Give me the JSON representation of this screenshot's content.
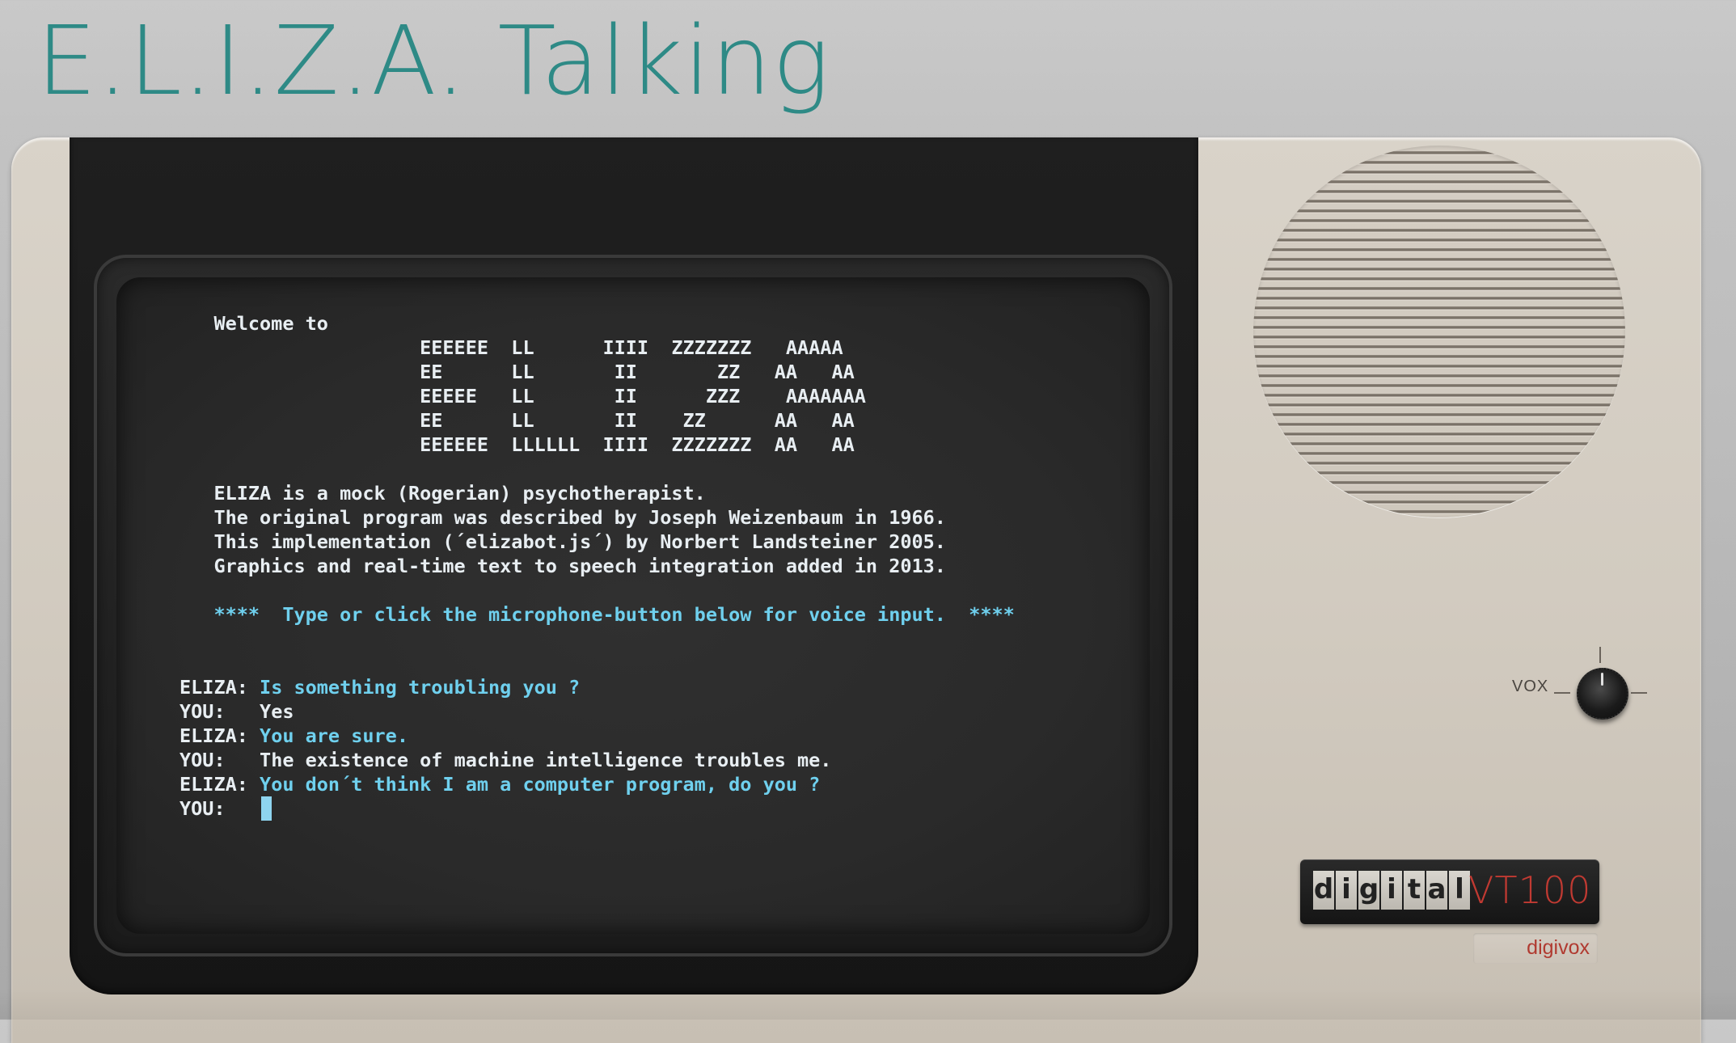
{
  "page": {
    "title": "E.L.I.Z.A. Talking"
  },
  "terminal": {
    "welcome_line": "   Welcome to",
    "banner": [
      "                     EEEEEE  LL      IIII  ZZZZZZZ   AAAAA",
      "                     EE      LL       II       ZZ   AA   AA",
      "                     EEEEE   LL       II      ZZZ    AAAAAAA",
      "                     EE      LL       II    ZZ      AA   AA",
      "                     EEEEEE  LLLLLL  IIII  ZZZZZZZ  AA   AA"
    ],
    "intro": [
      "   ELIZA is a mock (Rogerian) psychotherapist.",
      "   The original program was described by Joseph Weizenbaum in 1966.",
      "   This implementation (´elizabot.js´) by Norbert Landsteiner 2005.",
      "   Graphics and real-time text to speech integration added in 2013."
    ],
    "instruction": "   ****  Type or click the microphone-button below for voice input.  ****",
    "conversation": [
      {
        "speaker": "ELIZA: ",
        "text": "Is something troubling you ?"
      },
      {
        "speaker": "YOU:   ",
        "text": "Yes"
      },
      {
        "speaker": "ELIZA: ",
        "text": "You are sure."
      },
      {
        "speaker": "YOU:   ",
        "text": "The existence of machine intelligence troubles me."
      },
      {
        "speaker": "ELIZA: ",
        "text": "You don´t think I am a computer program, do you ?"
      }
    ],
    "prompt": {
      "speaker": "YOU:   ",
      "text": ""
    }
  },
  "controls": {
    "vox_label": "VOX",
    "vox_knob_icon": "rotary-knob-icon"
  },
  "branding": {
    "maker_letters": [
      "d",
      "i",
      "g",
      "i",
      "t",
      "a",
      "l"
    ],
    "model": "VT100",
    "sub_brand": "digivox"
  },
  "colors": {
    "title": "#2e8a86",
    "terminal_text": "#d9e3ea",
    "terminal_cyan": "#6fd0ee",
    "model": "#c13a32",
    "housing": "#d2cbc0"
  }
}
